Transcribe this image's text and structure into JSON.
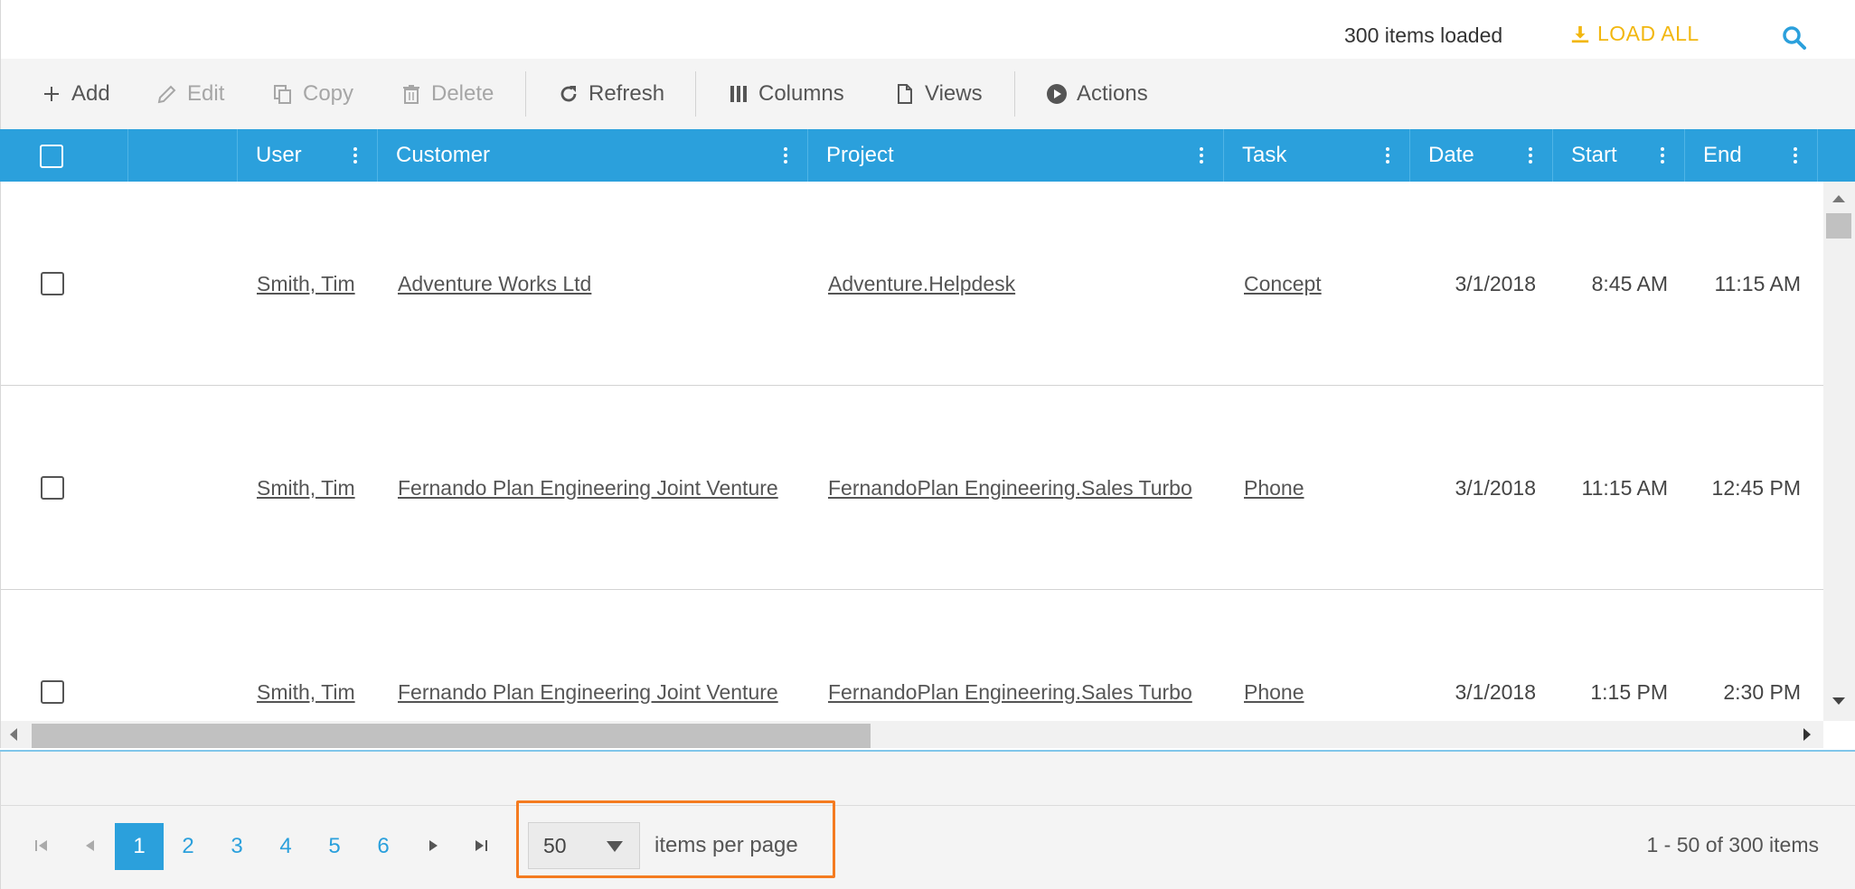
{
  "topbar": {
    "items_loaded": "300 items loaded",
    "load_all_label": "LOAD ALL",
    "search_icon": "search-icon"
  },
  "toolbar": {
    "add": "Add",
    "edit": "Edit",
    "copy": "Copy",
    "delete": "Delete",
    "refresh": "Refresh",
    "columns": "Columns",
    "views": "Views",
    "actions": "Actions"
  },
  "grid": {
    "columns": [
      "User",
      "Customer",
      "Project",
      "Task",
      "Date",
      "Start",
      "End"
    ],
    "rows": [
      {
        "user": "Smith, Tim",
        "customer": "Adventure Works Ltd",
        "project": "Adventure.Helpdesk",
        "task": "Concept",
        "date": "3/1/2018",
        "start": "8:45 AM",
        "end": "11:15 AM"
      },
      {
        "user": "Smith, Tim",
        "customer": "Fernando Plan Engineering Joint Venture",
        "project": "FernandoPlan Engineering.Sales Turbo",
        "task": "Phone",
        "date": "3/1/2018",
        "start": "11:15 AM",
        "end": "12:45 PM"
      },
      {
        "user": "Smith, Tim",
        "customer": "Fernando Plan Engineering Joint Venture",
        "project": "FernandoPlan Engineering.Sales Turbo",
        "task": "Phone",
        "date": "3/1/2018",
        "start": "1:15 PM",
        "end": "2:30 PM"
      }
    ]
  },
  "pager": {
    "pages": [
      "1",
      "2",
      "3",
      "4",
      "5",
      "6"
    ],
    "current_page": "1",
    "page_size": "50",
    "items_per_page_label": "items per page",
    "info": "1 - 50 of 300 items"
  },
  "colors": {
    "header_blue": "#2ba0dc",
    "load_all_yellow": "#f2b70f",
    "highlight_orange": "#f47b20"
  }
}
